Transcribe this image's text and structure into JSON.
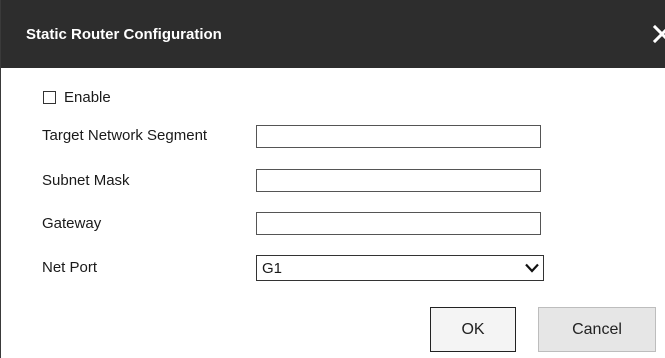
{
  "dialog": {
    "title": "Static Router Configuration",
    "close_icon": "close-icon"
  },
  "form": {
    "enable": {
      "label": "Enable",
      "checked": false
    },
    "target_network_segment": {
      "label": "Target Network Segment",
      "value": ""
    },
    "subnet_mask": {
      "label": "Subnet Mask",
      "value": ""
    },
    "gateway": {
      "label": "Gateway",
      "value": ""
    },
    "net_port": {
      "label": "Net Port",
      "selected": "G1",
      "icon": "chevron-down-icon"
    }
  },
  "buttons": {
    "ok_label": "OK",
    "cancel_label": "Cancel"
  },
  "colors": {
    "titlebar": "#2d2d2d",
    "title_text": "#ffffff",
    "background": "#ffffff"
  }
}
